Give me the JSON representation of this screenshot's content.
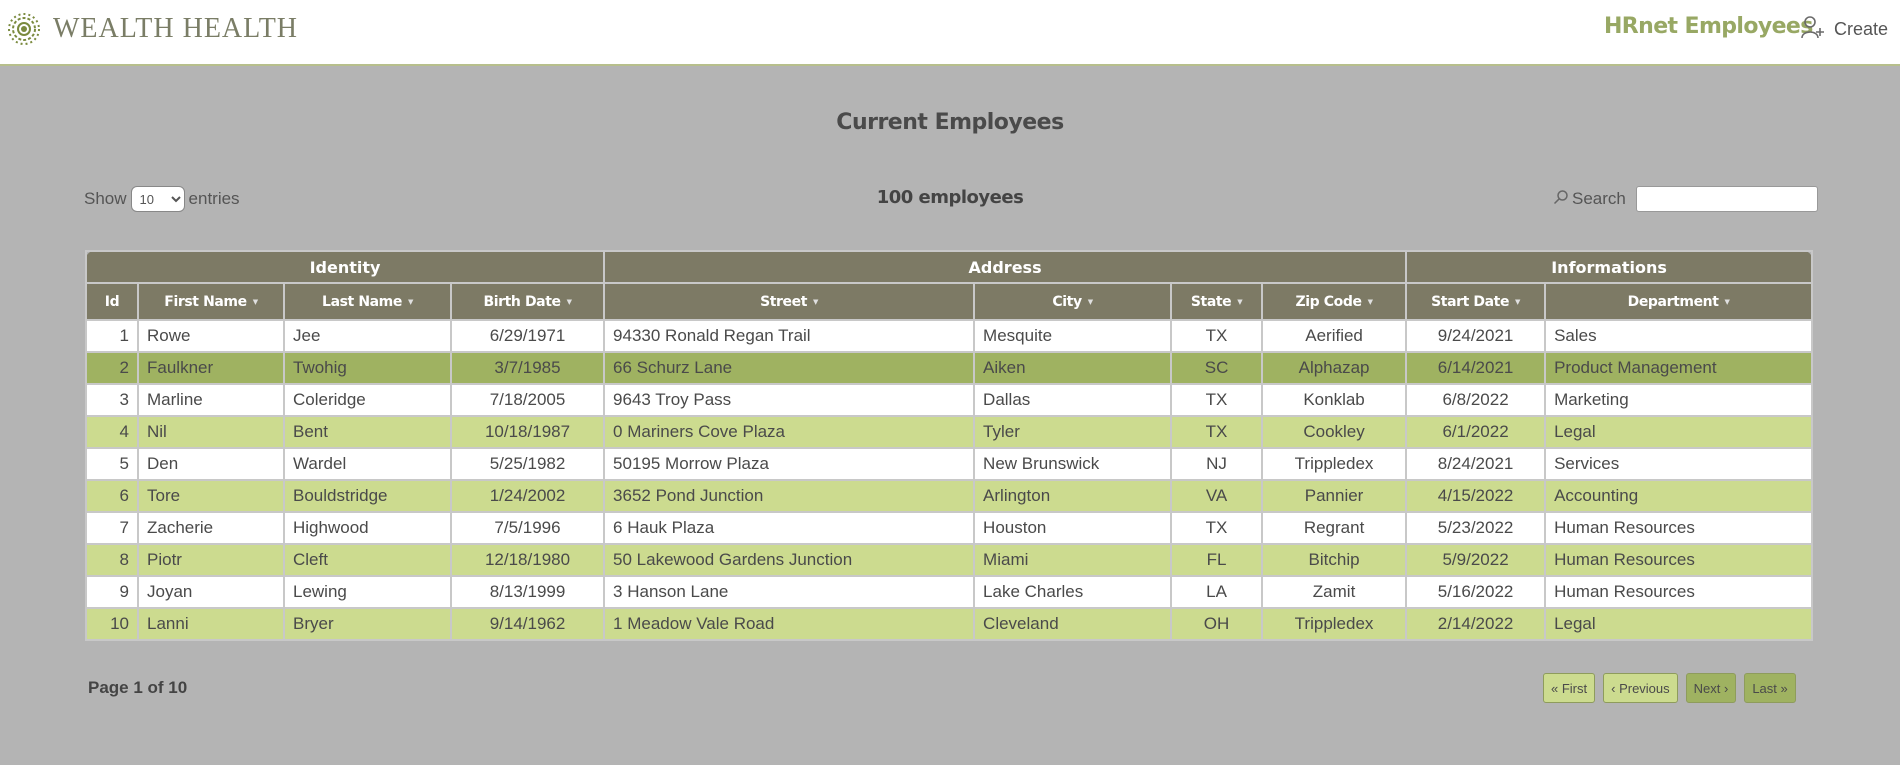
{
  "header": {
    "brand_name": "WEALTH HEALTH",
    "nav_title": "HRnet Employees",
    "create_label": "Create"
  },
  "page": {
    "title": "Current Employees",
    "show_label": "Show",
    "entries_label": "entries",
    "page_size": "10",
    "employee_count": "100 employees",
    "search_label": "Search",
    "search_value": "",
    "page_info": "Page 1 of 10"
  },
  "table": {
    "groups": [
      "Identity",
      "Address",
      "Informations"
    ],
    "columns": [
      "Id",
      "First Name",
      "Last Name",
      "Birth Date",
      "Street",
      "City",
      "State",
      "Zip Code",
      "Start Date",
      "Department"
    ],
    "rows": [
      [
        "1",
        "Rowe",
        "Jee",
        "6/29/1971",
        "94330 Ronald Regan Trail",
        "Mesquite",
        "TX",
        "Aerified",
        "9/24/2021",
        "Sales"
      ],
      [
        "2",
        "Faulkner",
        "Twohig",
        "3/7/1985",
        "66 Schurz Lane",
        "Aiken",
        "SC",
        "Alphazap",
        "6/14/2021",
        "Product Management"
      ],
      [
        "3",
        "Marline",
        "Coleridge",
        "7/18/2005",
        "9643 Troy Pass",
        "Dallas",
        "TX",
        "Konklab",
        "6/8/2022",
        "Marketing"
      ],
      [
        "4",
        "Nil",
        "Bent",
        "10/18/1987",
        "0 Mariners Cove Plaza",
        "Tyler",
        "TX",
        "Cookley",
        "6/1/2022",
        "Legal"
      ],
      [
        "5",
        "Den",
        "Wardel",
        "5/25/1982",
        "50195 Morrow Plaza",
        "New Brunswick",
        "NJ",
        "Trippledex",
        "8/24/2021",
        "Services"
      ],
      [
        "6",
        "Tore",
        "Bouldstridge",
        "1/24/2002",
        "3652 Pond Junction",
        "Arlington",
        "VA",
        "Pannier",
        "4/15/2022",
        "Accounting"
      ],
      [
        "7",
        "Zacherie",
        "Highwood",
        "7/5/1996",
        "6 Hauk Plaza",
        "Houston",
        "TX",
        "Regrant",
        "5/23/2022",
        "Human Resources"
      ],
      [
        "8",
        "Piotr",
        "Cleft",
        "12/18/1980",
        "50 Lakewood Gardens Junction",
        "Miami",
        "FL",
        "Bitchip",
        "5/9/2022",
        "Human Resources"
      ],
      [
        "9",
        "Joyan",
        "Lewing",
        "8/13/1999",
        "3 Hanson Lane",
        "Lake Charles",
        "LA",
        "Zamit",
        "5/16/2022",
        "Human Resources"
      ],
      [
        "10",
        "Lanni",
        "Bryer",
        "9/14/1962",
        "1 Meadow Vale Road",
        "Cleveland",
        "OH",
        "Trippledex",
        "2/14/2022",
        "Legal"
      ]
    ]
  },
  "pagination": {
    "first": "« First",
    "previous": "‹ Previous",
    "next": "Next ›",
    "last": "Last »"
  },
  "colors": {
    "accent": "#98a864",
    "row_alt": "#ccdb8f",
    "row_highlight": "#9fb261",
    "header_bg": "#7d7a65"
  },
  "icons": {
    "brand": "leaf-mandala-icon",
    "create": "add-user-icon",
    "search": "magnifier-icon",
    "sort": "sort-indicator-icon"
  }
}
